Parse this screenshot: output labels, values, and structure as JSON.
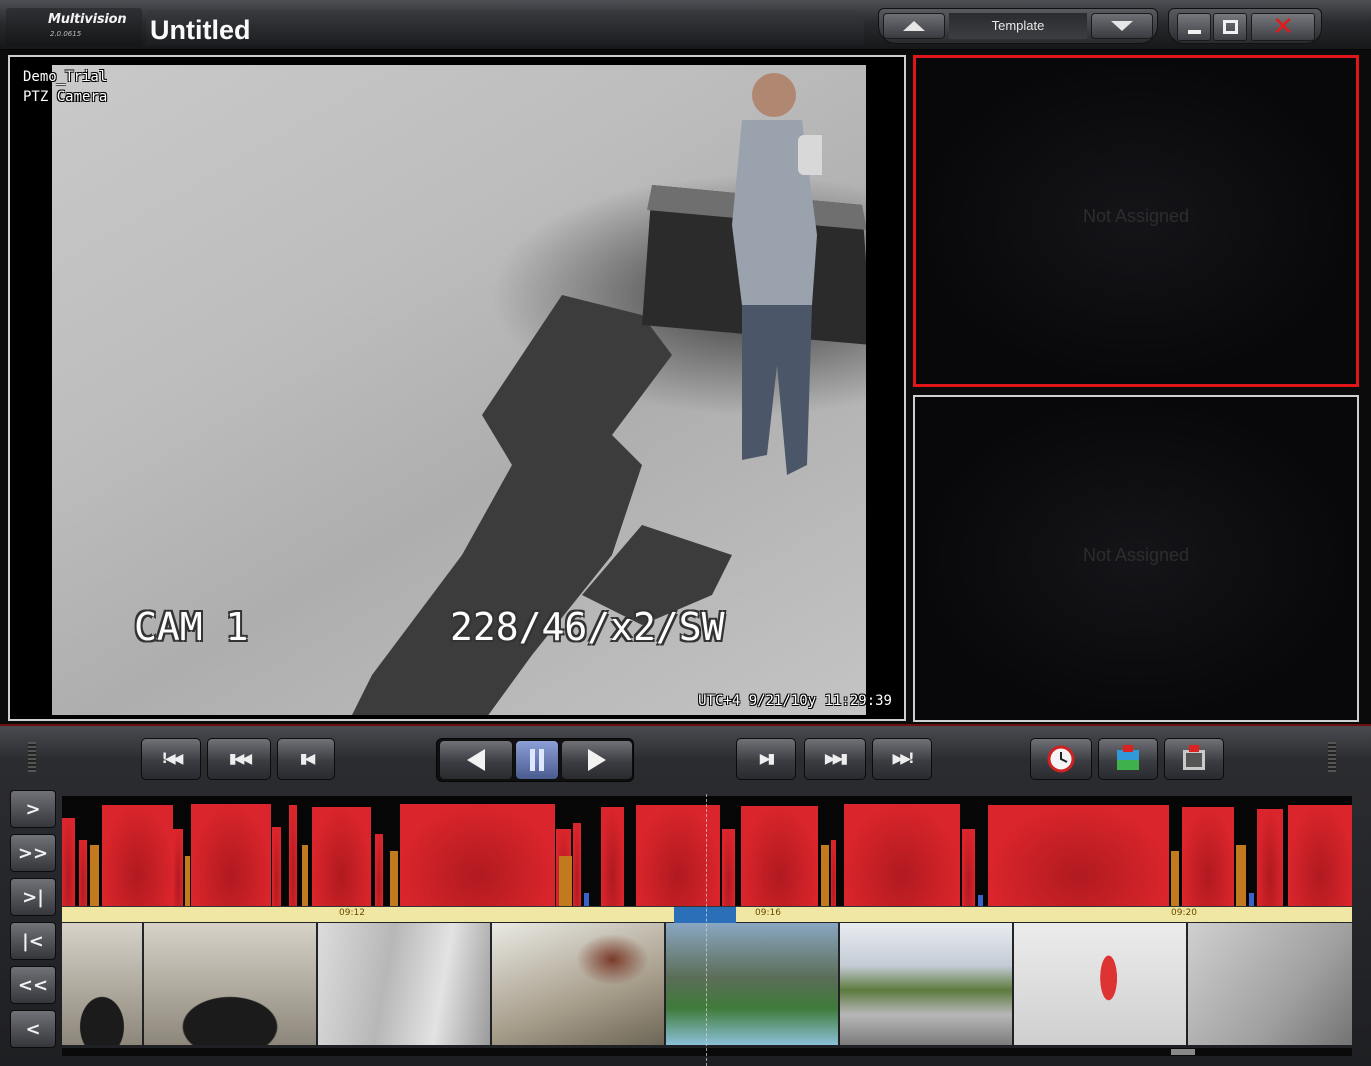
{
  "app": {
    "name": "Multivision",
    "version": "2.0.0615",
    "document_title": "Untitled"
  },
  "template": {
    "label": "Template"
  },
  "main_view": {
    "camera_site": "Demo_Trial",
    "camera_name": "PTZ Camera",
    "osd_cam": "CAM 1",
    "osd_ptz": "228/46/x2/SW",
    "timestamp": "UTC+4 9/21/10y 11:29:39"
  },
  "empty_panes": [
    "Not Assigned",
    "Not Assigned"
  ],
  "colors": {
    "selected_pane_border": "#e0151a",
    "recording": "#d9252b",
    "motion": "#c27a1e",
    "timeline_ruler": "#f1e7a4",
    "range_select": "#2a6fb8"
  },
  "playback_buttons": [
    {
      "name": "go-to-start",
      "icon": "skip-to-start-icon"
    },
    {
      "name": "previous-event",
      "icon": "fast-rewind-icon"
    },
    {
      "name": "step-back",
      "icon": "step-back-icon"
    },
    {
      "name": "play-reverse",
      "icon": "play-reverse-icon"
    },
    {
      "name": "pause",
      "icon": "pause-icon"
    },
    {
      "name": "play",
      "icon": "play-icon"
    },
    {
      "name": "step-forward",
      "icon": "step-forward-icon"
    },
    {
      "name": "next-event",
      "icon": "fast-forward-icon"
    },
    {
      "name": "go-to-live",
      "icon": "skip-to-live-icon"
    },
    {
      "name": "go-to-time",
      "icon": "clock-icon"
    },
    {
      "name": "snapshot",
      "icon": "snapshot-icon"
    },
    {
      "name": "export-clip",
      "icon": "film-export-icon"
    }
  ],
  "side_buttons": [
    ">",
    ">>",
    ">|",
    "|<",
    "<<",
    "<"
  ],
  "timeline": {
    "tick_labels": [
      "09:12",
      "09:16",
      "09:20"
    ],
    "segments": [
      {
        "pos": 0.0,
        "w": 0.01,
        "h": 0.8,
        "kind": "rec"
      },
      {
        "pos": 0.013,
        "w": 0.006,
        "h": 0.6,
        "kind": "rec"
      },
      {
        "pos": 0.022,
        "w": 0.007,
        "h": 0.55,
        "kind": "motion"
      },
      {
        "pos": 0.031,
        "w": 0.055,
        "h": 0.92,
        "kind": "rec"
      },
      {
        "pos": 0.086,
        "w": 0.008,
        "h": 0.7,
        "kind": "rec"
      },
      {
        "pos": 0.095,
        "w": 0.004,
        "h": 0.45,
        "kind": "motion"
      },
      {
        "pos": 0.1,
        "w": 0.062,
        "h": 0.93,
        "kind": "rec"
      },
      {
        "pos": 0.163,
        "w": 0.007,
        "h": 0.72,
        "kind": "rec"
      },
      {
        "pos": 0.176,
        "w": 0.006,
        "h": 0.92,
        "kind": "rec"
      },
      {
        "pos": 0.186,
        "w": 0.005,
        "h": 0.55,
        "kind": "motion"
      },
      {
        "pos": 0.194,
        "w": 0.046,
        "h": 0.9,
        "kind": "rec"
      },
      {
        "pos": 0.243,
        "w": 0.006,
        "h": 0.65,
        "kind": "rec"
      },
      {
        "pos": 0.254,
        "w": 0.006,
        "h": 0.5,
        "kind": "motion"
      },
      {
        "pos": 0.262,
        "w": 0.12,
        "h": 0.93,
        "kind": "rec"
      },
      {
        "pos": 0.383,
        "w": 0.012,
        "h": 0.7,
        "kind": "rec"
      },
      {
        "pos": 0.385,
        "w": 0.01,
        "h": 0.45,
        "kind": "motion"
      },
      {
        "pos": 0.396,
        "w": 0.006,
        "h": 0.75,
        "kind": "rec"
      },
      {
        "pos": 0.405,
        "w": 0.004,
        "h": 0.12,
        "kind": "event"
      },
      {
        "pos": 0.418,
        "w": 0.018,
        "h": 0.9,
        "kind": "rec"
      },
      {
        "pos": 0.445,
        "w": 0.065,
        "h": 0.92,
        "kind": "rec"
      },
      {
        "pos": 0.512,
        "w": 0.01,
        "h": 0.7,
        "kind": "rec"
      },
      {
        "pos": 0.526,
        "w": 0.06,
        "h": 0.91,
        "kind": "rec"
      },
      {
        "pos": 0.588,
        "w": 0.006,
        "h": 0.55,
        "kind": "motion"
      },
      {
        "pos": 0.596,
        "w": 0.004,
        "h": 0.6,
        "kind": "rec"
      },
      {
        "pos": 0.606,
        "w": 0.09,
        "h": 0.93,
        "kind": "rec"
      },
      {
        "pos": 0.698,
        "w": 0.01,
        "h": 0.7,
        "kind": "rec"
      },
      {
        "pos": 0.71,
        "w": 0.004,
        "h": 0.1,
        "kind": "event"
      },
      {
        "pos": 0.718,
        "w": 0.14,
        "h": 0.92,
        "kind": "rec"
      },
      {
        "pos": 0.86,
        "w": 0.006,
        "h": 0.5,
        "kind": "motion"
      },
      {
        "pos": 0.868,
        "w": 0.04,
        "h": 0.9,
        "kind": "rec"
      },
      {
        "pos": 0.91,
        "w": 0.008,
        "h": 0.55,
        "kind": "motion"
      },
      {
        "pos": 0.92,
        "w": 0.004,
        "h": 0.12,
        "kind": "event"
      },
      {
        "pos": 0.926,
        "w": 0.02,
        "h": 0.88,
        "kind": "rec"
      },
      {
        "pos": 0.95,
        "w": 0.05,
        "h": 0.92,
        "kind": "rec"
      }
    ],
    "tick_positions": [
      0.215,
      0.537,
      0.86
    ],
    "range_select_label": ""
  },
  "thumbnails": [
    {
      "name": "thumb-tunnel-1",
      "w": 80,
      "scene": "tunnel"
    },
    {
      "name": "thumb-tunnel-2",
      "w": 172,
      "scene": "tunnel"
    },
    {
      "name": "thumb-walkway",
      "w": 172,
      "scene": "walkway"
    },
    {
      "name": "thumb-dirt",
      "w": 172,
      "scene": "dirt"
    },
    {
      "name": "thumb-field",
      "w": 172,
      "scene": "field"
    },
    {
      "name": "thumb-city",
      "w": 172,
      "scene": "city"
    },
    {
      "name": "thumb-woman",
      "w": 172,
      "scene": "woman"
    },
    {
      "name": "thumb-street",
      "w": 172,
      "scene": "street"
    }
  ],
  "scroll": {
    "position": 0.86
  }
}
